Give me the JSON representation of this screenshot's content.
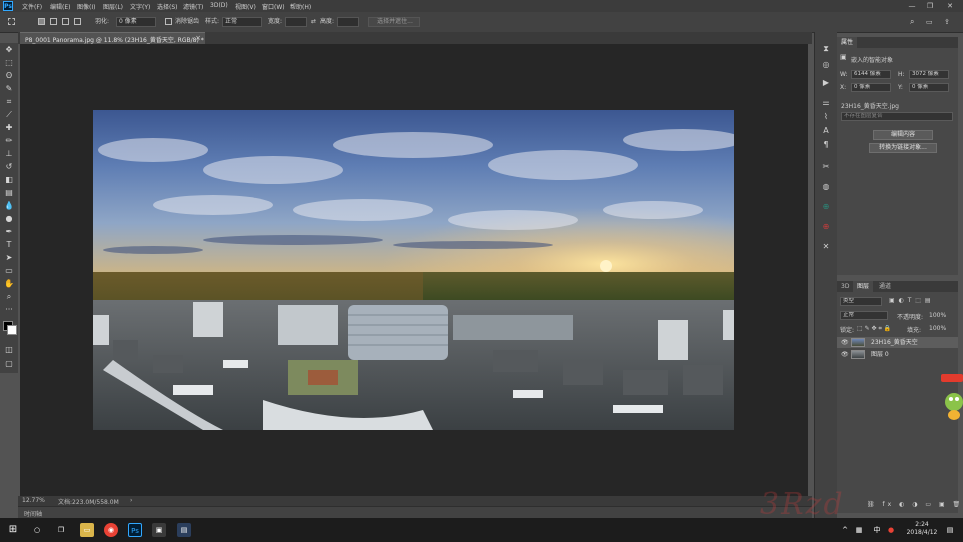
{
  "menubar": {
    "app_logo": "Ps",
    "items": [
      "文件(F)",
      "编辑(E)",
      "图像(I)",
      "图层(L)",
      "文字(Y)",
      "选择(S)",
      "滤镜(T)",
      "3D(D)",
      "视图(V)",
      "窗口(W)",
      "帮助(H)"
    ],
    "window_controls": [
      "—",
      "❐",
      "✕"
    ]
  },
  "options_bar": {
    "feather_label": "羽化:",
    "feather_value": "0 像素",
    "antialias_label": "消除锯齿",
    "style_label": "样式:",
    "style_value": "正常",
    "width_label": "宽度:",
    "height_label": "高度:",
    "refine_button": "选择并遮住..."
  },
  "document_tab": {
    "title": "P8_0001 Panorama.jpg @ 11.8% (23H16_黄昏天空, RGB/8) *",
    "close": "×"
  },
  "status_bar": {
    "zoom": "12.77%",
    "doc_info": "文档:223.0M/558.0M"
  },
  "timeline": {
    "label": "时间轴"
  },
  "properties_panel": {
    "tab": "属性",
    "header": "嵌入的智能对象",
    "w_label": "W:",
    "w_value": "6144 像素",
    "h_label": "H:",
    "h_value": "3072 像素",
    "x_label": "X:",
    "x_value": "0 像素",
    "y_label": "Y:",
    "y_value": "0 像素",
    "file_name": "23H16_黄昏天空.jpg",
    "comp_placeholder": "不存在图层复合",
    "edit_button": "编辑内容",
    "convert_button": "转换为链接对象..."
  },
  "layers_panel": {
    "tabs": [
      "3D",
      "图层",
      "通道"
    ],
    "kind_filter": "类型",
    "blend_mode": "正常",
    "opacity_label": "不透明度:",
    "opacity_value": "100%",
    "lock_label": "锁定:",
    "fill_label": "填充:",
    "fill_value": "100%",
    "layers": [
      {
        "name": "23H16_黄昏天空",
        "visible": "👁",
        "selected": true
      },
      {
        "name": "图层 0",
        "visible": "👁",
        "selected": false
      }
    ]
  },
  "taskbar": {
    "time": "2:24",
    "date": "2018/4/12",
    "ime": "中"
  },
  "watermark": {
    "text": "3Rzd"
  }
}
